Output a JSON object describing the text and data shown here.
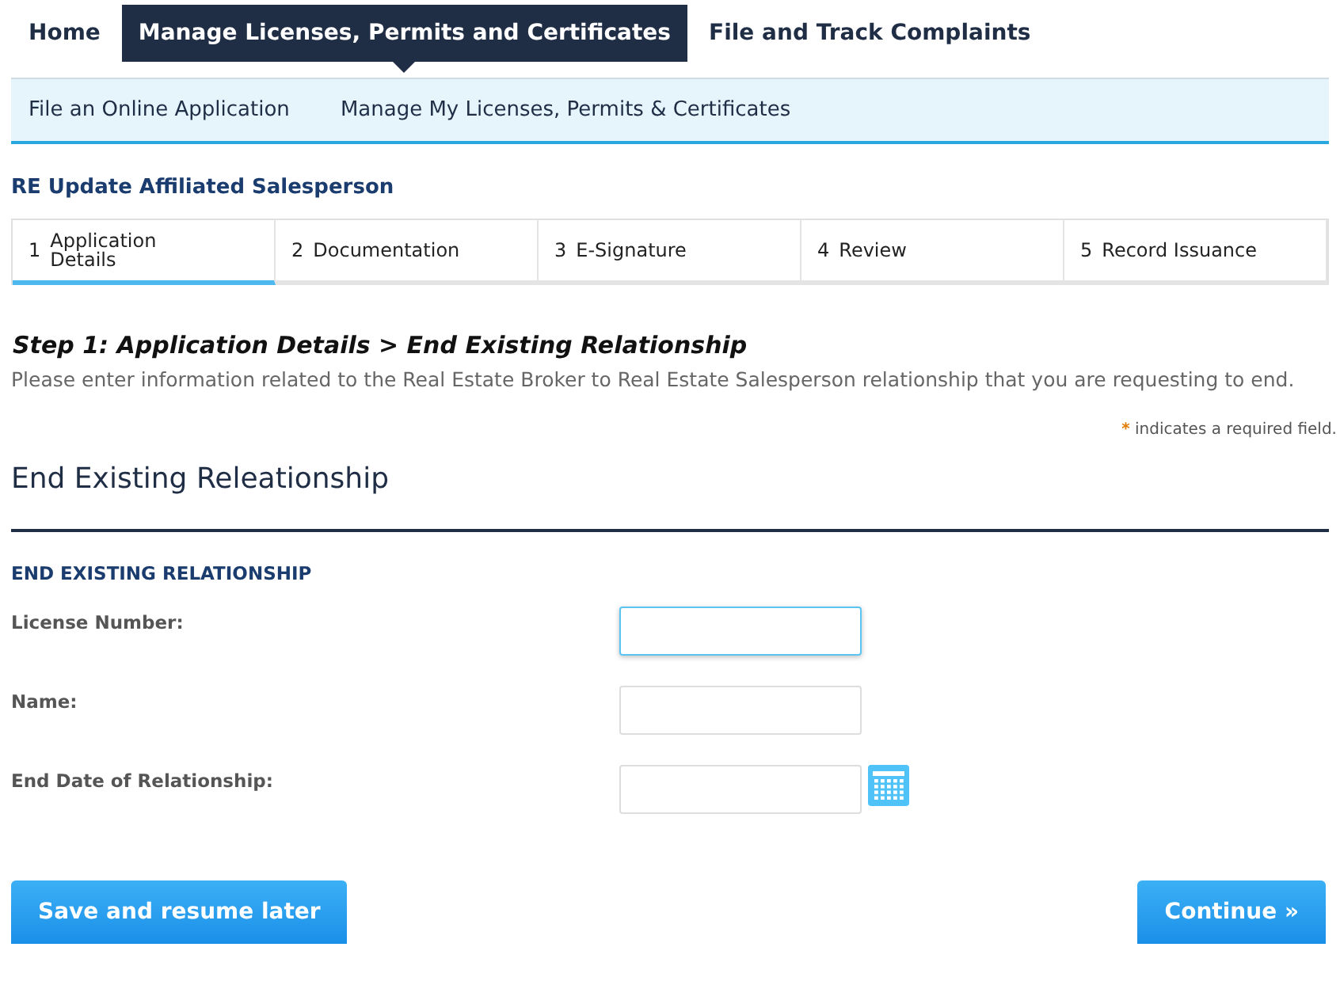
{
  "top_nav": [
    {
      "label": "Home",
      "selected": false
    },
    {
      "label": "Manage Licenses, Permits and Certificates",
      "selected": true
    },
    {
      "label": "File and Track Complaints",
      "selected": false
    }
  ],
  "sub_nav": [
    "File an Online Application",
    "Manage My Licenses, Permits & Certificates"
  ],
  "page_title": "RE Update Affiliated Salesperson",
  "steps": [
    {
      "number": "1",
      "label": "Application Details",
      "selected": true
    },
    {
      "number": "2",
      "label": "Documentation",
      "selected": false
    },
    {
      "number": "3",
      "label": "E-Signature",
      "selected": false
    },
    {
      "number": "4",
      "label": "Review",
      "selected": false
    },
    {
      "number": "5",
      "label": "Record Issuance",
      "selected": false
    }
  ],
  "step_heading": "Step 1: Application Details > End Existing Relationship",
  "description": "Please enter information related to the Real Estate Broker to Real Estate Salesperson relationship that you are requesting to end.",
  "required_note": {
    "mark": "*",
    "text": "indicates a required field."
  },
  "section_title": "End Existing Releationship",
  "subsection_title": "END EXISTING RELATIONSHIP",
  "fields": [
    {
      "label": "License Number:",
      "kind": "text",
      "focused": true
    },
    {
      "label": "Name:",
      "kind": "text",
      "focused": false
    },
    {
      "label": "End Date of Relationship:",
      "kind": "date",
      "focused": false
    }
  ],
  "buttons": {
    "save": "Save and resume later",
    "continue": "Continue »"
  }
}
